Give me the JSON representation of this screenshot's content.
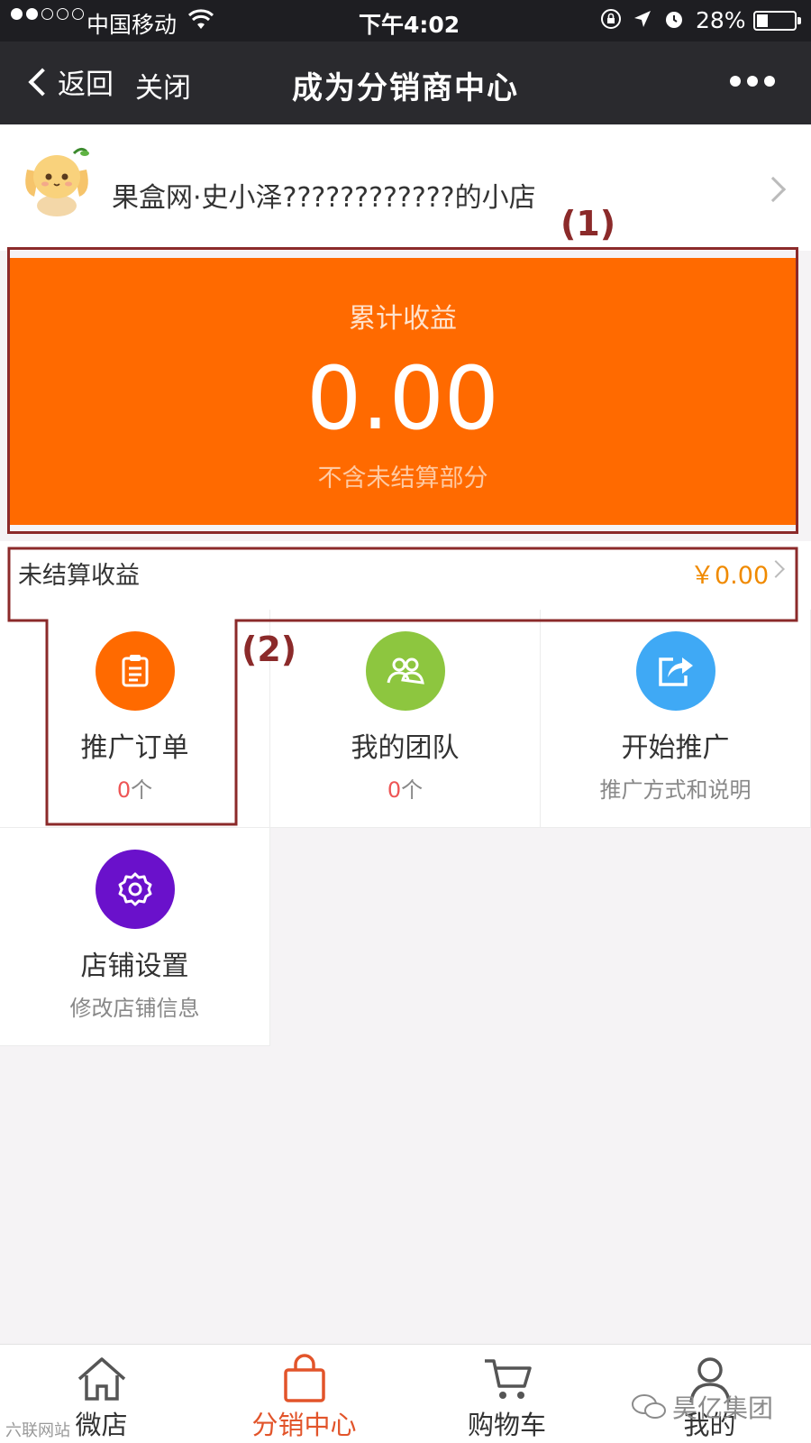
{
  "status_bar": {
    "carrier": "中国移动",
    "time": "下午4:02",
    "battery_percent": "28%",
    "signal_bars_filled": 2,
    "signal_bars_total": 5
  },
  "nav": {
    "back_label": "返回",
    "close_label": "关闭",
    "title": "成为分销商中心",
    "more_icon": "more-dots-icon"
  },
  "shop": {
    "name": "果盒网·史小泽????????????的小店"
  },
  "earnings": {
    "label": "累计收益",
    "value": "0.00",
    "note": "不含未结算部分"
  },
  "unsettled": {
    "label": "未结算收益",
    "value": "￥0.00"
  },
  "grid": [
    {
      "title": "推广订单",
      "sub_num": "0",
      "sub_unit": "个",
      "icon": "clipboard-icon",
      "color": "#ff6a00"
    },
    {
      "title": "我的团队",
      "sub_num": "0",
      "sub_unit": "个",
      "icon": "team-icon",
      "color": "#8dc63f"
    },
    {
      "title": "开始推广",
      "sub": "推广方式和说明",
      "icon": "share-icon",
      "color": "#3fa9f5"
    },
    {
      "title": "店铺设置",
      "sub": "修改店铺信息",
      "icon": "gear-icon",
      "color": "#6a11cb"
    }
  ],
  "annotations": {
    "box1": "(1)",
    "box2": "(2)"
  },
  "tabs": [
    {
      "label": "微店",
      "icon": "home-icon",
      "active": false
    },
    {
      "label": "分销中心",
      "icon": "bag-icon",
      "active": true
    },
    {
      "label": "购物车",
      "icon": "cart-icon",
      "active": false
    },
    {
      "label": "我的",
      "icon": "user-icon",
      "active": false
    }
  ],
  "watermarks": {
    "right": "昊亿集团",
    "left": "六联网站"
  },
  "colors": {
    "accent": "#ff6a00",
    "active_tab": "#e2542a",
    "annotation": "#8b2a2a",
    "unsettled_value": "#f08a00"
  }
}
